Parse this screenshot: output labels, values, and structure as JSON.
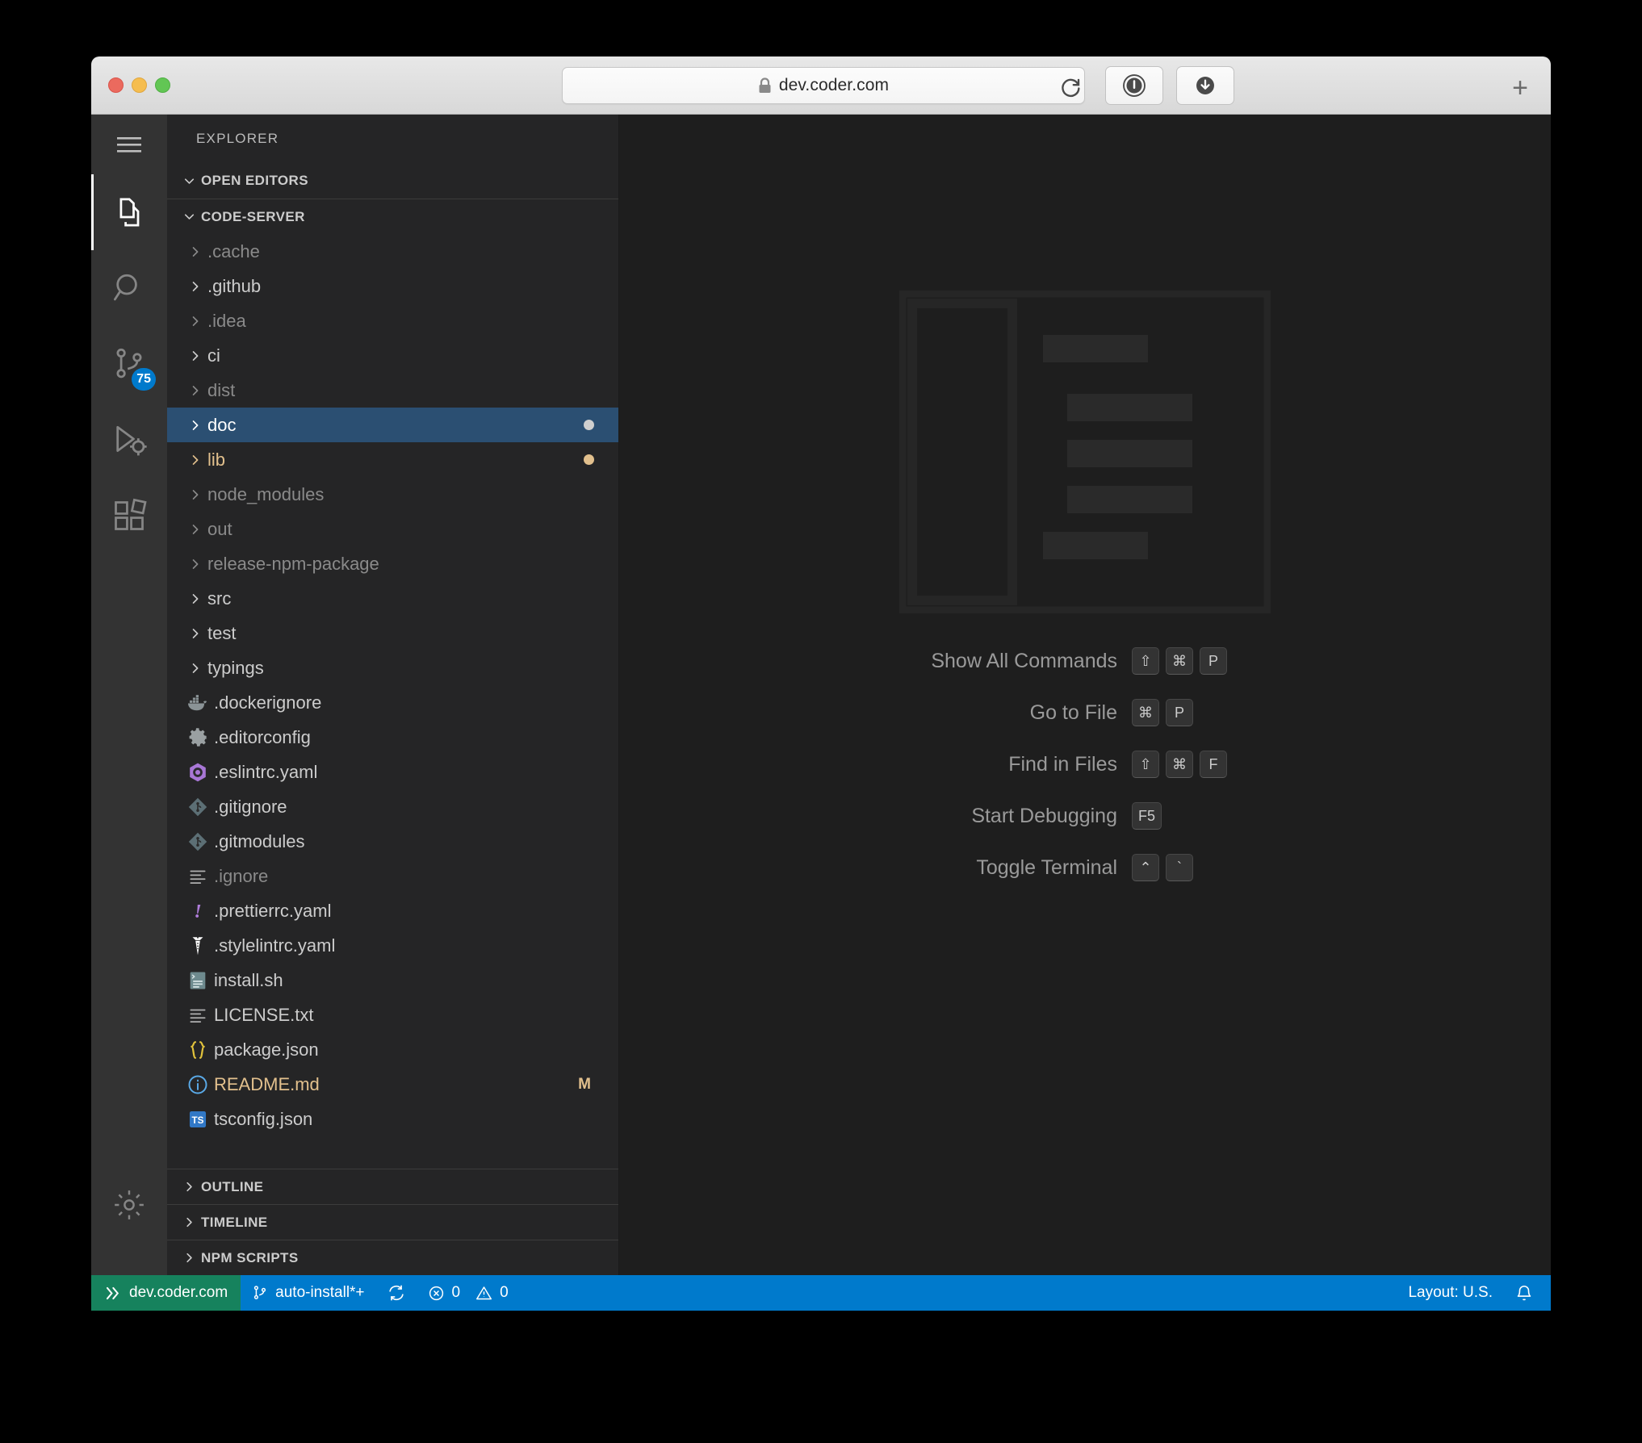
{
  "browser": {
    "url": "dev.coder.com",
    "lock_icon": "lock-icon",
    "reload_icon": "reload-icon",
    "onepassword_icon": "onepassword-icon",
    "download_icon": "download-icon",
    "new_tab_label": "+",
    "traffic_lights": [
      "close-button",
      "minimize-button",
      "zoom-button"
    ]
  },
  "activity_bar": {
    "items": [
      {
        "name": "menu-icon",
        "label": "Menu",
        "badge": null,
        "active": false
      },
      {
        "name": "explorer-icon",
        "label": "Explorer",
        "badge": null,
        "active": true
      },
      {
        "name": "search-icon",
        "label": "Search",
        "badge": null,
        "active": false
      },
      {
        "name": "source-control-icon",
        "label": "Source Control",
        "badge": "75",
        "active": false
      },
      {
        "name": "run-debug-icon",
        "label": "Run and Debug",
        "badge": null,
        "active": false
      },
      {
        "name": "extensions-icon",
        "label": "Extensions",
        "badge": null,
        "active": false
      }
    ],
    "manage_icon": "gear-icon",
    "badge_color": "#007acc"
  },
  "sidebar": {
    "title": "EXPLORER",
    "sections": [
      {
        "label": "OPEN EDITORS",
        "expanded": true
      },
      {
        "label": "CODE-SERVER",
        "expanded": true
      }
    ],
    "bottom_sections": [
      {
        "label": "OUTLINE",
        "expanded": false
      },
      {
        "label": "TIMELINE",
        "expanded": false
      },
      {
        "label": "NPM SCRIPTS",
        "expanded": false
      }
    ],
    "tree": [
      {
        "label": ".cache",
        "type": "folder",
        "state": "dim",
        "icon": null,
        "decoration": null
      },
      {
        "label": ".github",
        "type": "folder",
        "state": "normal",
        "icon": null,
        "decoration": null
      },
      {
        "label": ".idea",
        "type": "folder",
        "state": "dim",
        "icon": null,
        "decoration": null
      },
      {
        "label": "ci",
        "type": "folder",
        "state": "normal",
        "icon": null,
        "decoration": null
      },
      {
        "label": "dist",
        "type": "folder",
        "state": "dim",
        "icon": null,
        "decoration": null
      },
      {
        "label": "doc",
        "type": "folder",
        "state": "selected",
        "icon": null,
        "decoration": "dot-blue"
      },
      {
        "label": "lib",
        "type": "folder",
        "state": "modified",
        "icon": null,
        "decoration": "dot-yellow"
      },
      {
        "label": "node_modules",
        "type": "folder",
        "state": "dim",
        "icon": null,
        "decoration": null
      },
      {
        "label": "out",
        "type": "folder",
        "state": "dim",
        "icon": null,
        "decoration": null
      },
      {
        "label": "release-npm-package",
        "type": "folder",
        "state": "dim",
        "icon": null,
        "decoration": null
      },
      {
        "label": "src",
        "type": "folder",
        "state": "normal",
        "icon": null,
        "decoration": null
      },
      {
        "label": "test",
        "type": "folder",
        "state": "normal",
        "icon": null,
        "decoration": null
      },
      {
        "label": "typings",
        "type": "folder",
        "state": "normal",
        "icon": null,
        "decoration": null
      },
      {
        "label": ".dockerignore",
        "type": "file",
        "state": "normal",
        "icon": "docker-icon",
        "decoration": null
      },
      {
        "label": ".editorconfig",
        "type": "file",
        "state": "normal",
        "icon": "gear-icon",
        "decoration": null
      },
      {
        "label": ".eslintrc.yaml",
        "type": "file",
        "state": "normal",
        "icon": "eslint-icon",
        "decoration": null
      },
      {
        "label": ".gitignore",
        "type": "file",
        "state": "normal",
        "icon": "git-icon",
        "decoration": null
      },
      {
        "label": ".gitmodules",
        "type": "file",
        "state": "normal",
        "icon": "git-icon",
        "decoration": null
      },
      {
        "label": ".ignore",
        "type": "file",
        "state": "dim",
        "icon": "text-lines-icon",
        "decoration": null
      },
      {
        "label": ".prettierrc.yaml",
        "type": "file",
        "state": "normal",
        "icon": "prettier-icon",
        "decoration": null
      },
      {
        "label": ".stylelintrc.yaml",
        "type": "file",
        "state": "normal",
        "icon": "stylelint-icon",
        "decoration": null
      },
      {
        "label": "install.sh",
        "type": "file",
        "state": "normal",
        "icon": "shell-icon",
        "decoration": null
      },
      {
        "label": "LICENSE.txt",
        "type": "file",
        "state": "normal",
        "icon": "text-lines-icon",
        "decoration": null
      },
      {
        "label": "package.json",
        "type": "file",
        "state": "normal",
        "icon": "json-icon",
        "decoration": null
      },
      {
        "label": "README.md",
        "type": "file",
        "state": "modified",
        "icon": "info-icon",
        "decoration": "M"
      },
      {
        "label": "tsconfig.json",
        "type": "file",
        "state": "normal",
        "icon": "tsconfig-icon",
        "decoration": null
      }
    ]
  },
  "editor": {
    "watermark_icon": "vscode-watermark-icon",
    "shortcuts": [
      {
        "label": "Show All Commands",
        "keys": [
          "⇧",
          "⌘",
          "P"
        ]
      },
      {
        "label": "Go to File",
        "keys": [
          "⌘",
          "P"
        ]
      },
      {
        "label": "Find in Files",
        "keys": [
          "⇧",
          "⌘",
          "F"
        ]
      },
      {
        "label": "Start Debugging",
        "keys": [
          "F5"
        ]
      },
      {
        "label": "Toggle Terminal",
        "keys": [
          "⌃",
          "`"
        ]
      }
    ]
  },
  "status_bar": {
    "remote": {
      "label": "dev.coder.com",
      "icon": "remote-icon",
      "color": "#16825d"
    },
    "branch": {
      "label": "auto-install*+",
      "icon": "branch-icon"
    },
    "sync_icon": "sync-icon",
    "errors": {
      "label": "0",
      "icon": "error-icon"
    },
    "warnings": {
      "label": "0",
      "icon": "warning-icon"
    },
    "layout": "Layout: U.S.",
    "bell_icon": "bell-icon",
    "color": "#007acc"
  }
}
